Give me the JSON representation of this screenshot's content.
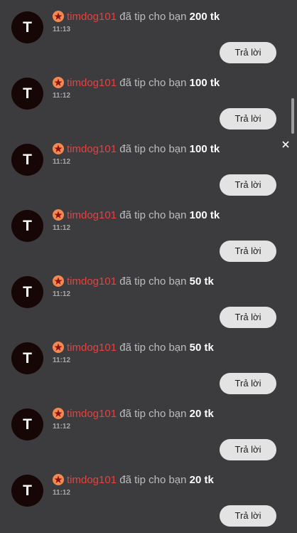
{
  "notifications": [
    {
      "avatar_letter": "T",
      "username": "timdog101",
      "message": "đã tip cho bạn",
      "amount": "200 tk",
      "time": "11:13",
      "reply_label": "Trả lời"
    },
    {
      "avatar_letter": "T",
      "username": "timdog101",
      "message": "đã tip cho bạn",
      "amount": "100 tk",
      "time": "11:12",
      "reply_label": "Trả lời"
    },
    {
      "avatar_letter": "T",
      "username": "timdog101",
      "message": "đã tip cho bạn",
      "amount": "100 tk",
      "time": "11:12",
      "reply_label": "Trả lời"
    },
    {
      "avatar_letter": "T",
      "username": "timdog101",
      "message": "đã tip cho bạn",
      "amount": "100 tk",
      "time": "11:12",
      "reply_label": "Trả lời"
    },
    {
      "avatar_letter": "T",
      "username": "timdog101",
      "message": "đã tip cho bạn",
      "amount": "50 tk",
      "time": "11:12",
      "reply_label": "Trả lời"
    },
    {
      "avatar_letter": "T",
      "username": "timdog101",
      "message": "đã tip cho bạn",
      "amount": "50 tk",
      "time": "11:12",
      "reply_label": "Trả lời"
    },
    {
      "avatar_letter": "T",
      "username": "timdog101",
      "message": "đã tip cho bạn",
      "amount": "20 tk",
      "time": "11:12",
      "reply_label": "Trả lời"
    },
    {
      "avatar_letter": "T",
      "username": "timdog101",
      "message": "đã tip cho bạn",
      "amount": "20 tk",
      "time": "11:12",
      "reply_label": "Trả lời"
    }
  ],
  "icons": {
    "badge": "star-badge-icon",
    "close": "close-icon"
  },
  "colors": {
    "background": "#3c3c3e",
    "username": "#e8403f",
    "badge": "#f28a52",
    "reply_button": "#e3e3e3",
    "avatar": "#160606"
  }
}
